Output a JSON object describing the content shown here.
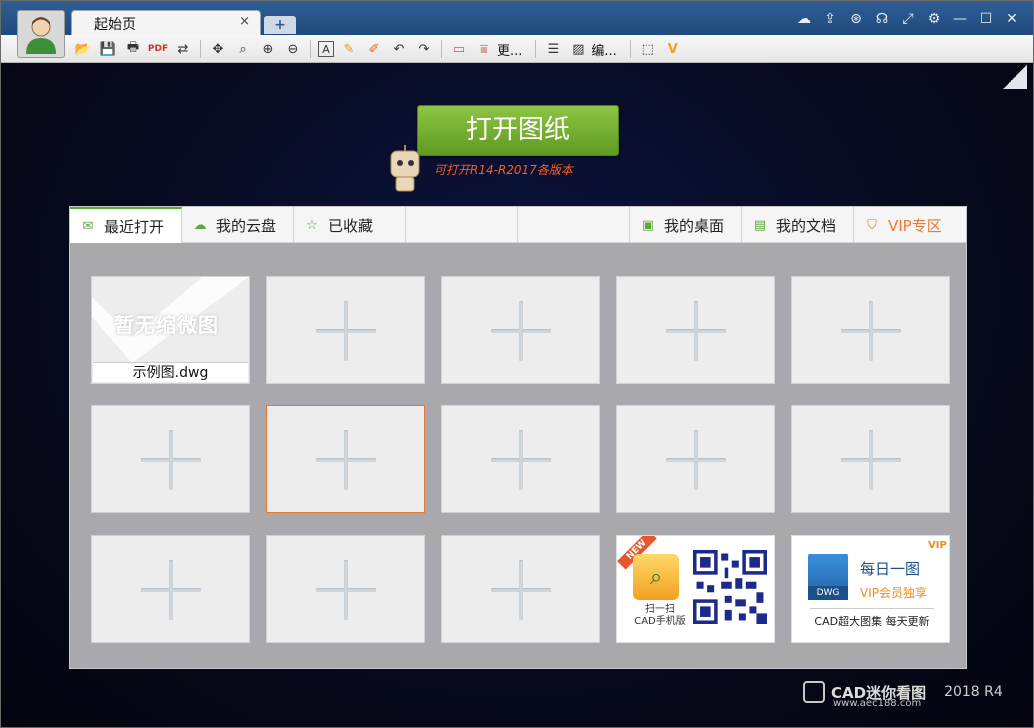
{
  "window": {
    "tab_label": "起始页",
    "tab_close": "×",
    "new_tab": "+",
    "window_icons": [
      "cloud-icon",
      "share-icon",
      "link-icon",
      "headset-icon",
      "fullscreen-icon",
      "settings-icon",
      "minimize-icon",
      "maximize-icon",
      "close-icon"
    ]
  },
  "toolbar": {
    "more_label_1": "更...",
    "more_label_2": "编...",
    "tools": [
      "open-folder-icon",
      "save-icon",
      "print-icon",
      "pdf-icon",
      "export-icon",
      "pan-icon",
      "zoom-window-icon",
      "zoom-in-icon",
      "zoom-out-icon",
      "text-icon",
      "pencil-icon",
      "highlight-icon",
      "undo-icon",
      "redo-icon",
      "measure-icon",
      "dimension-icon",
      "layers-icon",
      "edit-icon",
      "select-icon",
      "vip-icon"
    ]
  },
  "open_button": {
    "label": "打开图纸",
    "note": "可打开R14-R2017各版本"
  },
  "panel_tabs": [
    {
      "label": "最近打开",
      "icon": "mail-icon"
    },
    {
      "label": "我的云盘",
      "icon": "cloud-icon"
    },
    {
      "label": "已收藏",
      "icon": "star-icon"
    },
    {
      "label": "",
      "icon": ""
    },
    {
      "label": "",
      "icon": ""
    },
    {
      "label": "我的桌面",
      "icon": "desktop-icon"
    },
    {
      "label": "我的文档",
      "icon": "document-icon"
    },
    {
      "label": "VIP专区",
      "icon": "vip-icon"
    }
  ],
  "recent": {
    "thumb_placeholder": "暂无缩微图",
    "file_name": "示例图.dwg"
  },
  "ads": {
    "mobile": {
      "badge": "NEW",
      "line1": "扫一扫",
      "line2": "CAD手机版"
    },
    "daily": {
      "title": "每日一图",
      "badge": "VIP",
      "subtitle": "VIP会员独享",
      "footer": "CAD超大图集 每天更新",
      "logo_label": "DWG"
    }
  },
  "brand": {
    "name": "CAD迷你看图",
    "version": "2018 R4",
    "url": "www.aec188.com"
  },
  "colors": {
    "titlebar": "#2f5f95",
    "accent_green": "#6aa82b",
    "note_orange": "#ff5a1a",
    "vip_orange": "#ef7a2f",
    "selected_border": "#e8782d"
  }
}
